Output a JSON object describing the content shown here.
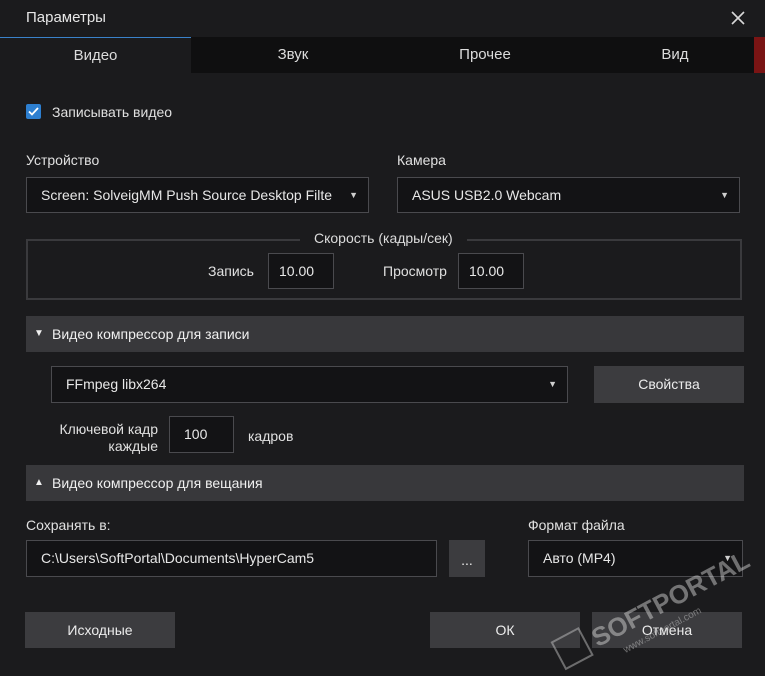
{
  "window": {
    "title": "Параметры"
  },
  "tabs": [
    {
      "label": "Видео"
    },
    {
      "label": "Звук"
    },
    {
      "label": "Прочее"
    },
    {
      "label": "Вид"
    }
  ],
  "record_video": {
    "label": "Записывать видео",
    "checked": true
  },
  "device": {
    "label": "Устройство",
    "value": "Screen: SolveigMM Push Source Desktop Filte"
  },
  "camera": {
    "label": "Камера",
    "value": "ASUS USB2.0 Webcam"
  },
  "speed": {
    "title": "Скорость (кадры/сек)",
    "record_label": "Запись",
    "record_value": "10.00",
    "preview_label": "Просмотр",
    "preview_value": "10.00"
  },
  "record_compressor": {
    "title": "Видео компрессор для записи",
    "value": "FFmpeg libx264",
    "properties_label": "Свойства",
    "keyframe_label_1": "Ключевой кадр",
    "keyframe_label_2": "каждые",
    "keyframe_value": "100",
    "keyframe_unit": "кадров"
  },
  "stream_compressor": {
    "title": "Видео компрессор для вещания"
  },
  "save": {
    "label": "Сохранять в:",
    "path": "C:\\Users\\SoftPortal\\Documents\\HyperCam5",
    "browse_label": "..."
  },
  "file_format": {
    "label": "Формат файла",
    "value": "Авто (MP4)"
  },
  "buttons": {
    "defaults": "Исходные",
    "ok": "ОК",
    "cancel": "Отмена"
  },
  "watermark": {
    "text": "SOFTPORTAL",
    "url": "www.softportal.com"
  },
  "colors": {
    "accent": "#2d7fd0",
    "background": "#1b1b1d",
    "section": "#38383b"
  }
}
